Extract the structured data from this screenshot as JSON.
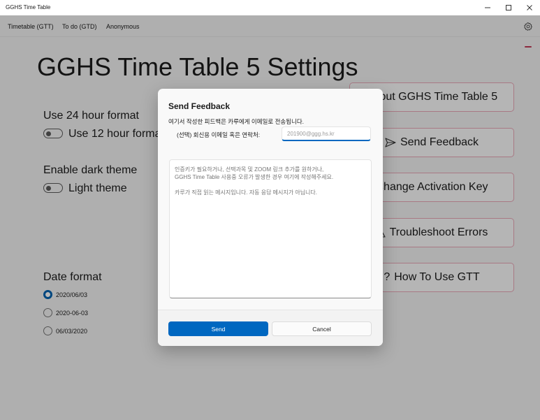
{
  "window": {
    "title": "GGHS Time Table",
    "controls": {
      "minimize": "—",
      "maximize": "☐",
      "close": "✕"
    }
  },
  "nav": {
    "items": [
      {
        "label": "Timetable (GTT)"
      },
      {
        "label": "To do (GTD)"
      },
      {
        "label": "Anonymous"
      }
    ],
    "settings_icon": "gear-icon",
    "accent": "#c13a56"
  },
  "settings": {
    "title": "GGHS Time Table 5 Settings",
    "hour_format": {
      "header": "Use 24 hour format",
      "toggle_label": "Use 12 hour format"
    },
    "theme": {
      "header": "Enable dark theme",
      "toggle_label": "Light theme"
    },
    "date_format": {
      "header": "Date format",
      "options": [
        "2020/06/03",
        "2020-06-03",
        "06/03/2020"
      ],
      "selected": "2020/06/03"
    },
    "side_buttons": [
      {
        "label": "About GGHS Time Table 5",
        "icon": ""
      },
      {
        "label": "Send Feedback",
        "icon": "send-icon"
      },
      {
        "label": "Change Activation Key",
        "icon": ""
      },
      {
        "label": "Troubleshoot Errors",
        "icon": "warning-icon"
      },
      {
        "label": "How To Use GTT",
        "icon": "question-icon"
      }
    ]
  },
  "dialog": {
    "title": "Send Feedback",
    "description": "여기서 작성한 피드백은 카루에게 이메일로 전송됩니다.",
    "contact_label": "(선택) 회신용 이메일 혹은 연락처:",
    "contact_placeholder": "201900@ggg.hs.kr",
    "message_placeholder": "인증키가 필요하거나, 선택과목 및 ZOOM 링크 추가를 원하거나,\nGGHS Time Table 사용중 오류가 발생한 경우 여기에 작성해주세요.\n\n카루가 직접 읽는 메시지입니다. 자동 응답 메시지가 아닙니다.",
    "send_label": "Send",
    "cancel_label": "Cancel",
    "primary_color": "#0067c0"
  }
}
